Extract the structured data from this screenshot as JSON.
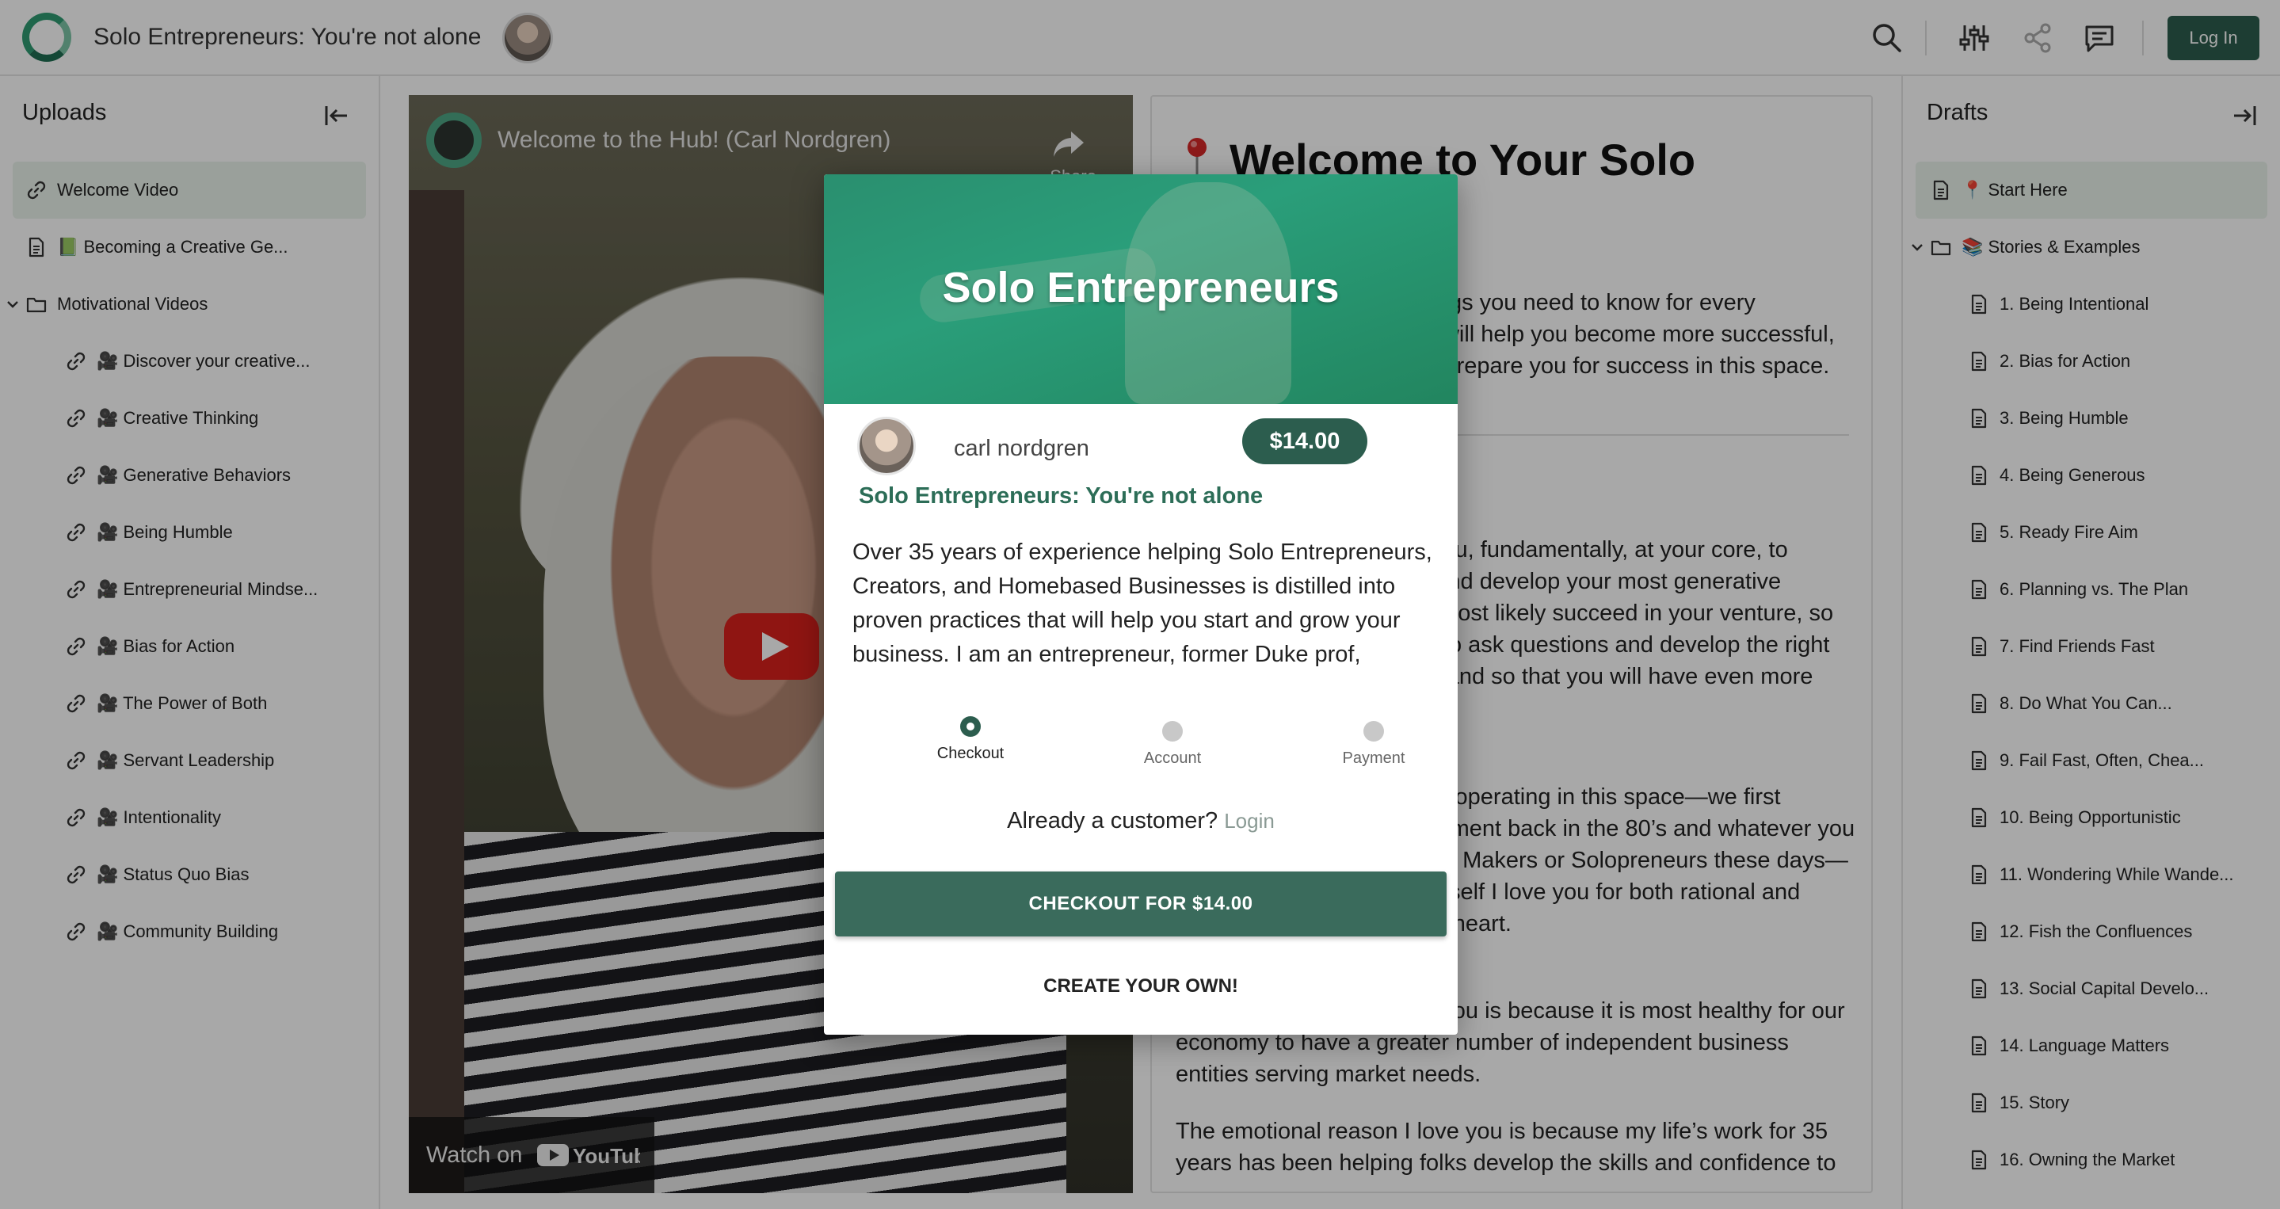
{
  "app": {
    "title": "Solo Entrepreneurs: You're not alone",
    "login_label": "Log In",
    "accent_color": "#2c5d4e",
    "brand_green": "#2a9e7a"
  },
  "left_sidebar": {
    "title": "Uploads",
    "items": [
      {
        "label": "Welcome Video",
        "icon": "link-icon",
        "indent": 0,
        "active": true
      },
      {
        "label": "📗 Becoming a Creative Ge...",
        "icon": "document-icon",
        "indent": 0
      },
      {
        "label": "Motivational Videos",
        "icon": "folder-icon",
        "indent": 0,
        "expandable": true
      },
      {
        "label": "🎥 Discover your creative...",
        "icon": "link-icon",
        "indent": 1
      },
      {
        "label": "🎥 Creative Thinking",
        "icon": "link-icon",
        "indent": 1
      },
      {
        "label": "🎥 Generative Behaviors",
        "icon": "link-icon",
        "indent": 1
      },
      {
        "label": "🎥 Being Humble",
        "icon": "link-icon",
        "indent": 1
      },
      {
        "label": "🎥 Entrepreneurial Mindse...",
        "icon": "link-icon",
        "indent": 1
      },
      {
        "label": "🎥 Bias for Action",
        "icon": "link-icon",
        "indent": 1
      },
      {
        "label": "🎥 The Power of Both",
        "icon": "link-icon",
        "indent": 1
      },
      {
        "label": "🎥 Servant Leadership",
        "icon": "link-icon",
        "indent": 1
      },
      {
        "label": "🎥 Intentionality",
        "icon": "link-icon",
        "indent": 1
      },
      {
        "label": "🎥 Status Quo Bias",
        "icon": "link-icon",
        "indent": 1
      },
      {
        "label": "🎥 Community Building",
        "icon": "link-icon",
        "indent": 1
      }
    ]
  },
  "video": {
    "title": "Welcome to the Hub! (Carl Nordgren)",
    "share_label": "Share",
    "watch_label": "Watch on",
    "platform": "YouTube"
  },
  "doc": {
    "title": "Welcome to Your Solo Adventure",
    "paragraphs": [
      "These are some of the things you need to know for every entrepreneur and how we will help you become more successful, as well as the best way to prepare you for success in this space.",
      "We are designed to help you, fundamentally, at your core, to develop creative thinking and develop your most generative behaviors so that you will most likely succeed in your venture, so that you will be more able to ask questions and develop the right answers in your business, and so that you will have even more fun.",
      "We have been serving and operating in this space—we first identified this business segment back in the 80’s and whatever you call it, it’s called Creators or Makers or Solopreneurs these days—and whatever you call yourself I love you for both rational and pragmatic reasons and my heart.",
      "The rational reason I love you is because it is most healthy for our economy to have a greater number of independent business entities serving market needs.",
      "The emotional reason I love you is because my life’s work for 35 years has been helping folks develop the skills and confidence to"
    ]
  },
  "right_sidebar": {
    "title": "Drafts",
    "items": [
      {
        "label": "📍 Start Here",
        "icon": "document-icon",
        "indent": 0,
        "active": true
      },
      {
        "label": "📚 Stories & Examples",
        "icon": "folder-icon",
        "indent": 0,
        "expandable": true
      },
      {
        "label": "1. Being Intentional",
        "icon": "document-icon",
        "indent": 1
      },
      {
        "label": "2. Bias for Action",
        "icon": "document-icon",
        "indent": 1
      },
      {
        "label": "3. Being Humble",
        "icon": "document-icon",
        "indent": 1
      },
      {
        "label": "4. Being Generous",
        "icon": "document-icon",
        "indent": 1
      },
      {
        "label": "5. Ready Fire Aim",
        "icon": "document-icon",
        "indent": 1
      },
      {
        "label": "6. Planning vs. The Plan",
        "icon": "document-icon",
        "indent": 1
      },
      {
        "label": "7. Find Friends Fast",
        "icon": "document-icon",
        "indent": 1
      },
      {
        "label": "8. Do What You Can...",
        "icon": "document-icon",
        "indent": 1
      },
      {
        "label": "9. Fail Fast, Often, Chea...",
        "icon": "document-icon",
        "indent": 1
      },
      {
        "label": "10. Being Opportunistic",
        "icon": "document-icon",
        "indent": 1
      },
      {
        "label": "11. Wondering While Wande...",
        "icon": "document-icon",
        "indent": 1
      },
      {
        "label": "12. Fish the Confluences",
        "icon": "document-icon",
        "indent": 1
      },
      {
        "label": "13. Social Capital Develo...",
        "icon": "document-icon",
        "indent": 1
      },
      {
        "label": "14. Language Matters",
        "icon": "document-icon",
        "indent": 1
      },
      {
        "label": "15. Story",
        "icon": "document-icon",
        "indent": 1
      },
      {
        "label": "16. Owning the Market",
        "icon": "document-icon",
        "indent": 1
      }
    ]
  },
  "modal": {
    "banner_title": "Solo Entrepreneurs",
    "author": "carl nordgren",
    "price": "$14.00",
    "subtitle": "Solo Entrepreneurs: You're not alone",
    "description": "Over 35 years of experience helping Solo Entrepreneurs, Creators, and Homebased Businesses is distilled into proven practices that will help you start and grow your business. I am an entrepreneur, former Duke prof,",
    "steps": [
      {
        "label": "Checkout",
        "active": true
      },
      {
        "label": "Account",
        "active": false
      },
      {
        "label": "Payment",
        "active": false
      }
    ],
    "already_customer": "Already a customer?",
    "login_link": "Login",
    "checkout_button": "CHECKOUT FOR $14.00",
    "create_button": "CREATE YOUR OWN!"
  }
}
